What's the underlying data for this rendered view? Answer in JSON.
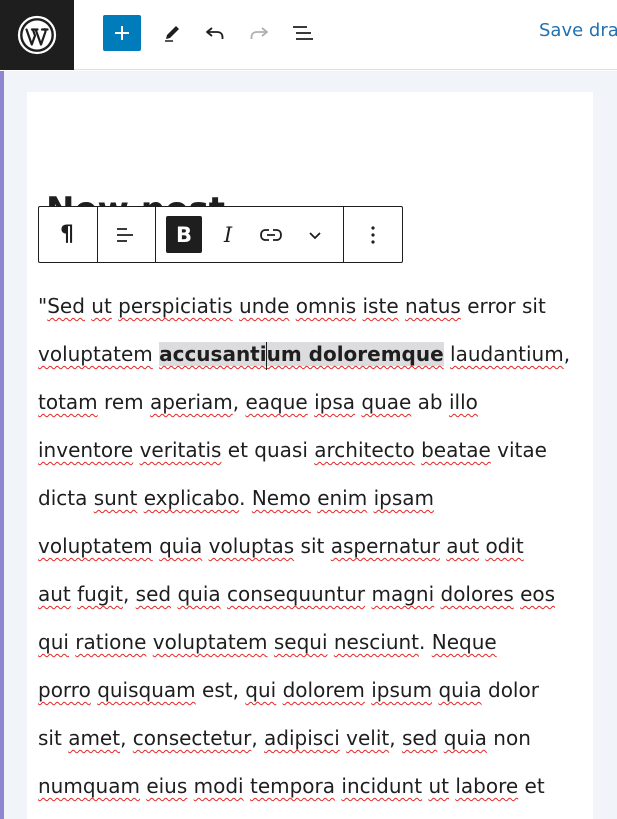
{
  "topbar": {
    "logo_icon": "wordpress-logo-icon",
    "add_block_icon": "plus-icon",
    "tools_icon": "pencil-icon",
    "undo_icon": "undo-icon",
    "redo_icon": "redo-icon",
    "outline_icon": "list-view-icon",
    "save_draft_label": "Save draf",
    "accent_color": "#007cba",
    "link_color": "#2271b1"
  },
  "editor": {
    "title": "New post",
    "block_toolbar": {
      "paragraph_glyph": "¶",
      "bold_glyph": "B",
      "italic_glyph": "I",
      "align_icon": "align-left-icon",
      "link_icon": "link-icon",
      "more_icon": "chevron-down-icon",
      "options_icon": "more-vertical-icon"
    },
    "paragraph": {
      "lines": [
        [
          {
            "t": "\""
          },
          {
            "t": "Sed",
            "sp": true
          },
          {
            "t": " "
          },
          {
            "t": "ut",
            "sp": true
          },
          {
            "t": " "
          },
          {
            "t": "perspiciatis",
            "sp": true
          },
          {
            "t": " "
          },
          {
            "t": "unde",
            "sp": true
          },
          {
            "t": " "
          },
          {
            "t": "omnis",
            "sp": true
          },
          {
            "t": " "
          },
          {
            "t": "iste",
            "sp": true
          },
          {
            "t": " "
          },
          {
            "t": "natus",
            "sp": true
          },
          {
            "t": " error sit"
          }
        ],
        [
          {
            "t": "voluptatem",
            "sp": true
          },
          {
            "t": " "
          },
          {
            "t": "accusanti",
            "sel": true,
            "sp": true
          },
          {
            "caret": true
          },
          {
            "t": "um doloremque",
            "sel": true,
            "sp": true
          },
          {
            "t": " "
          },
          {
            "t": "laudantium",
            "sp": true
          },
          {
            "t": ","
          }
        ],
        [
          {
            "t": "totam",
            "sp": true
          },
          {
            "t": " rem "
          },
          {
            "t": "aperiam",
            "sp": true
          },
          {
            "t": ", "
          },
          {
            "t": "eaque",
            "sp": true
          },
          {
            "t": " "
          },
          {
            "t": "ipsa",
            "sp": true
          },
          {
            "t": " "
          },
          {
            "t": "quae",
            "sp": true
          },
          {
            "t": " ab "
          },
          {
            "t": "illo",
            "sp": true
          }
        ],
        [
          {
            "t": "inventore",
            "sp": true
          },
          {
            "t": " "
          },
          {
            "t": "veritatis",
            "sp": true
          },
          {
            "t": " et quasi "
          },
          {
            "t": "architecto",
            "sp": true
          },
          {
            "t": " "
          },
          {
            "t": "beatae",
            "sp": true
          },
          {
            "t": " vitae"
          }
        ],
        [
          {
            "t": "dicta "
          },
          {
            "t": "sunt",
            "sp": true
          },
          {
            "t": " "
          },
          {
            "t": "explicabo",
            "sp": true
          },
          {
            "t": ". "
          },
          {
            "t": "Nemo",
            "sp": true
          },
          {
            "t": " "
          },
          {
            "t": "enim",
            "sp": true
          },
          {
            "t": " "
          },
          {
            "t": "ipsam",
            "sp": true
          }
        ],
        [
          {
            "t": "voluptatem",
            "sp": true
          },
          {
            "t": " "
          },
          {
            "t": "quia",
            "sp": true
          },
          {
            "t": " "
          },
          {
            "t": "voluptas",
            "sp": true
          },
          {
            "t": " sit "
          },
          {
            "t": "aspernatur",
            "sp": true
          },
          {
            "t": " "
          },
          {
            "t": "aut",
            "sp": true
          },
          {
            "t": " "
          },
          {
            "t": "odit",
            "sp": true
          }
        ],
        [
          {
            "t": "aut",
            "sp": true
          },
          {
            "t": " "
          },
          {
            "t": "fugit",
            "sp": true
          },
          {
            "t": ", "
          },
          {
            "t": "sed",
            "sp": true
          },
          {
            "t": " "
          },
          {
            "t": "quia",
            "sp": true
          },
          {
            "t": " "
          },
          {
            "t": "consequuntur",
            "sp": true
          },
          {
            "t": " "
          },
          {
            "t": "magni",
            "sp": true
          },
          {
            "t": " "
          },
          {
            "t": "dolores",
            "sp": true
          },
          {
            "t": " "
          },
          {
            "t": "eos",
            "sp": true
          }
        ],
        [
          {
            "t": "qui",
            "sp": true
          },
          {
            "t": " "
          },
          {
            "t": "ratione",
            "sp": true
          },
          {
            "t": " "
          },
          {
            "t": "voluptatem",
            "sp": true
          },
          {
            "t": " "
          },
          {
            "t": "sequi",
            "sp": true
          },
          {
            "t": " "
          },
          {
            "t": "nesciunt",
            "sp": true
          },
          {
            "t": ". "
          },
          {
            "t": "Neque",
            "sp": true
          }
        ],
        [
          {
            "t": "porro",
            "sp": true
          },
          {
            "t": " "
          },
          {
            "t": "quisquam",
            "sp": true
          },
          {
            "t": " est, "
          },
          {
            "t": "qui",
            "sp": true
          },
          {
            "t": " "
          },
          {
            "t": "dolorem",
            "sp": true
          },
          {
            "t": " "
          },
          {
            "t": "ipsum",
            "sp": true
          },
          {
            "t": " "
          },
          {
            "t": "quia",
            "sp": true
          },
          {
            "t": " dolor"
          }
        ],
        [
          {
            "t": "sit "
          },
          {
            "t": "amet",
            "sp": true
          },
          {
            "t": ", "
          },
          {
            "t": "consectetur",
            "sp": true
          },
          {
            "t": ", "
          },
          {
            "t": "adipisci",
            "sp": true
          },
          {
            "t": " "
          },
          {
            "t": "velit",
            "sp": true
          },
          {
            "t": ", "
          },
          {
            "t": "sed",
            "sp": true
          },
          {
            "t": " "
          },
          {
            "t": "quia",
            "sp": true
          },
          {
            "t": " non"
          }
        ],
        [
          {
            "t": "numquam",
            "sp": true
          },
          {
            "t": " "
          },
          {
            "t": "eius",
            "sp": true
          },
          {
            "t": " "
          },
          {
            "t": "modi",
            "sp": true
          },
          {
            "t": " "
          },
          {
            "t": "tempora",
            "sp": true
          },
          {
            "t": " "
          },
          {
            "t": "incidunt",
            "sp": true
          },
          {
            "t": " "
          },
          {
            "t": "ut",
            "sp": true
          },
          {
            "t": " "
          },
          {
            "t": "labore",
            "sp": true
          },
          {
            "t": " et"
          }
        ]
      ]
    }
  }
}
